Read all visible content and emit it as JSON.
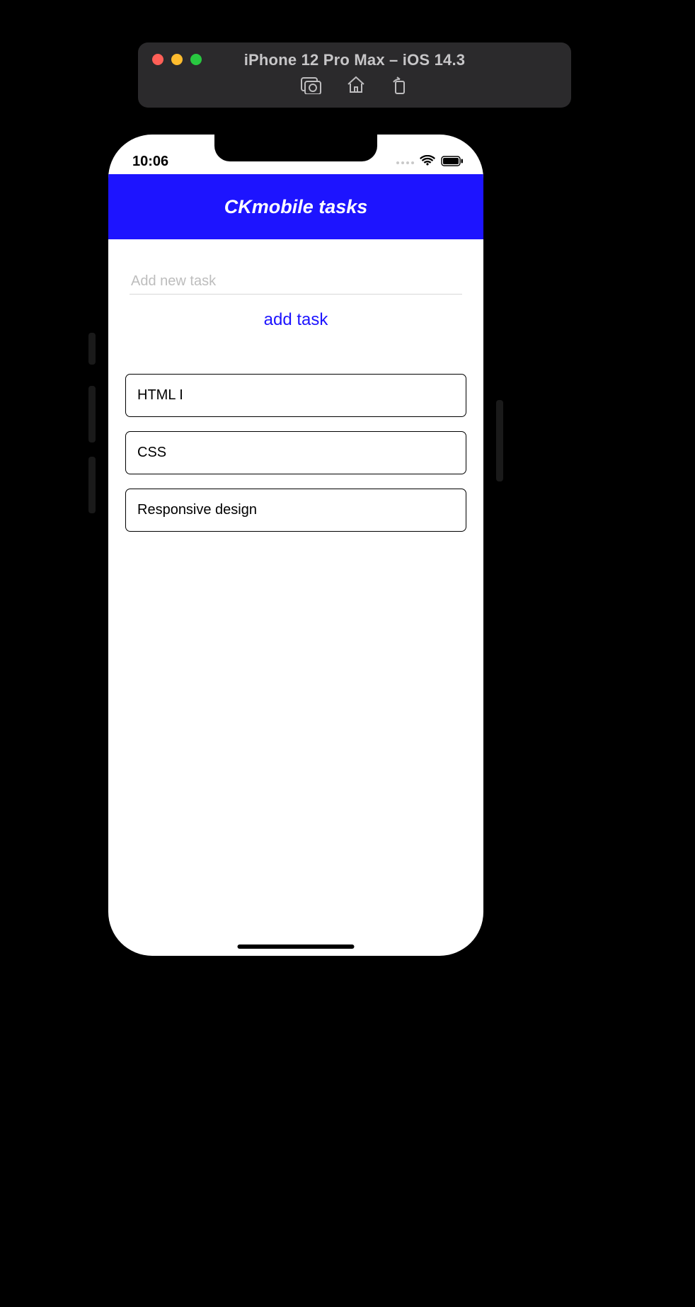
{
  "simulator": {
    "window_title": "iPhone 12 Pro Max – iOS 14.3",
    "toolbar": {
      "screenshot": "screenshot-icon",
      "home": "home-icon",
      "rotate": "rotate-icon"
    }
  },
  "status_bar": {
    "time": "10:06"
  },
  "app": {
    "header_title": "CKmobile tasks",
    "input_placeholder": "Add new task",
    "input_value": "",
    "add_button_label": "add task",
    "tasks": [
      {
        "title": "HTML I"
      },
      {
        "title": "CSS"
      },
      {
        "title": "Responsive design"
      }
    ]
  },
  "colors": {
    "accent": "#1d14ff"
  }
}
